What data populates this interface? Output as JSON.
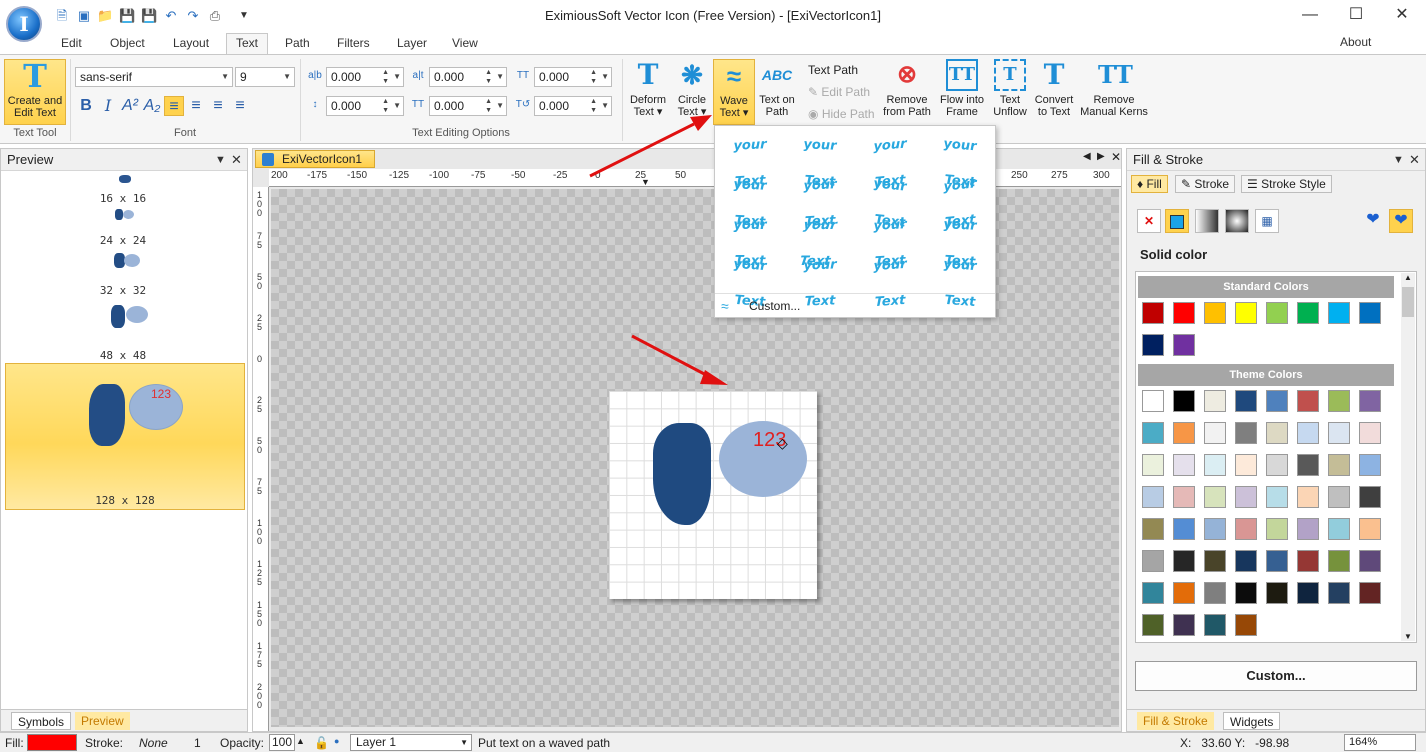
{
  "titlebar": {
    "title": "EximiousSoft Vector Icon (Free Version) - [ExiVectorIcon1]",
    "min_icon": "minimize-icon",
    "max_icon": "maximize-icon",
    "close_icon": "close-icon"
  },
  "menu": {
    "tabs": [
      "Edit",
      "Object",
      "Layout",
      "Text",
      "Path",
      "Filters",
      "Layer",
      "View"
    ],
    "active": "Text",
    "about": "About"
  },
  "ribbon": {
    "create_edit_text": "Create and Edit Text",
    "group_text_tool": "Text Tool",
    "font_family": "sans-serif",
    "font_size": "9",
    "group_font": "Font",
    "spin_values": [
      "0.000",
      "0.000",
      "0.000",
      "0.000",
      "0.000",
      "0.000"
    ],
    "group_text_editing": "Text Editing Options",
    "deform_text": "Deform Text",
    "circle_text": "Circle Text",
    "wave_text": "Wave Text",
    "text_on_path": "Text on Path",
    "text_path": "Text Path",
    "edit_path": "Edit Path",
    "hide_path": "Hide Path",
    "remove_from_path": "Remove from Path",
    "flow_into_frame": "Flow into Frame",
    "text_unflow": "Text Unflow",
    "convert_to_text": "Convert to Text",
    "remove_manual_kerns": "Remove Manual Kerns"
  },
  "wave_dropdown": {
    "sample": "your Text",
    "custom": "Custom..."
  },
  "preview": {
    "title": "Preview",
    "sizes": [
      "16 x 16",
      "24 x 24",
      "32 x 32",
      "48 x 48",
      "128 x 128"
    ],
    "badge_text": "123",
    "bottom_tabs": [
      "Symbols",
      "Preview"
    ]
  },
  "document": {
    "tab": "ExiVectorIcon1",
    "ruler_h": [
      "200",
      "-175",
      "-150",
      "-125",
      "-100",
      "-75",
      "-50",
      "-25",
      "0",
      "25",
      "50",
      "250",
      "275",
      "300"
    ],
    "ruler_v": [
      "1\n0\n0",
      "7\n5",
      "5\n0",
      "2\n5",
      "0",
      "2\n5",
      "5\n0",
      "7\n5",
      "1\n0\n0",
      "1\n2\n5",
      "1\n5\n0",
      "1\n7\n5",
      "2\n0\n0"
    ],
    "canvas_text": "123"
  },
  "fill_stroke": {
    "title": "Fill & Stroke",
    "tabs": [
      "Fill",
      "Stroke",
      "Stroke Style"
    ],
    "mode": "Solid color",
    "standard_colors_label": "Standard Colors",
    "theme_colors_label": "Theme Colors",
    "standard_colors": [
      "#c00000",
      "#ff0000",
      "#ffc000",
      "#ffff00",
      "#92d050",
      "#00b050",
      "#00b0f0",
      "#0070c0",
      "#002060",
      "#7030a0"
    ],
    "theme_colors": [
      "#ffffff",
      "#000000",
      "#eeece1",
      "#1f497d",
      "#4f81bd",
      "#c0504d",
      "#9bbb59",
      "#8064a2",
      "#4bacc6",
      "#f79646",
      "#f2f2f2",
      "#7f7f7f",
      "#ddd9c3",
      "#c6d9f0",
      "#dbe5f1",
      "#f2dcdb",
      "#ebf1dd",
      "#e5e0ec",
      "#dbeef3",
      "#fdeada",
      "#d8d8d8",
      "#595959",
      "#c4bd97",
      "#8db3e2",
      "#b8cce4",
      "#e5b9b7",
      "#d7e3bc",
      "#ccc1d9",
      "#b7dde8",
      "#fbd5b5",
      "#bfbfbf",
      "#3f3f3f",
      "#938953",
      "#548dd4",
      "#95b3d7",
      "#d99694",
      "#c3d69b",
      "#b2a2c7",
      "#92cddc",
      "#fac08f",
      "#a5a5a5",
      "#262626",
      "#494429",
      "#17365d",
      "#366092",
      "#953734",
      "#76923c",
      "#5f497a",
      "#31859b",
      "#e36c09",
      "#7f7f7f",
      "#0c0c0c",
      "#1d1b10",
      "#0f243e",
      "#244061",
      "#632423",
      "#4f6128",
      "#3f3151",
      "#205867",
      "#974806"
    ],
    "custom_button": "Custom...",
    "bottom_tabs": [
      "Fill & Stroke",
      "Widgets"
    ]
  },
  "status": {
    "fill_label": "Fill:",
    "fill_color": "#ff0000",
    "stroke_label": "Stroke:",
    "stroke_value": "None",
    "stroke_width": "1",
    "opacity_label": "Opacity:",
    "opacity_value": "100",
    "layer": "Layer 1",
    "hint": "Put text on a waved path",
    "coords": "X:   33.60 Y:   -98.98",
    "zoom": "164%"
  }
}
